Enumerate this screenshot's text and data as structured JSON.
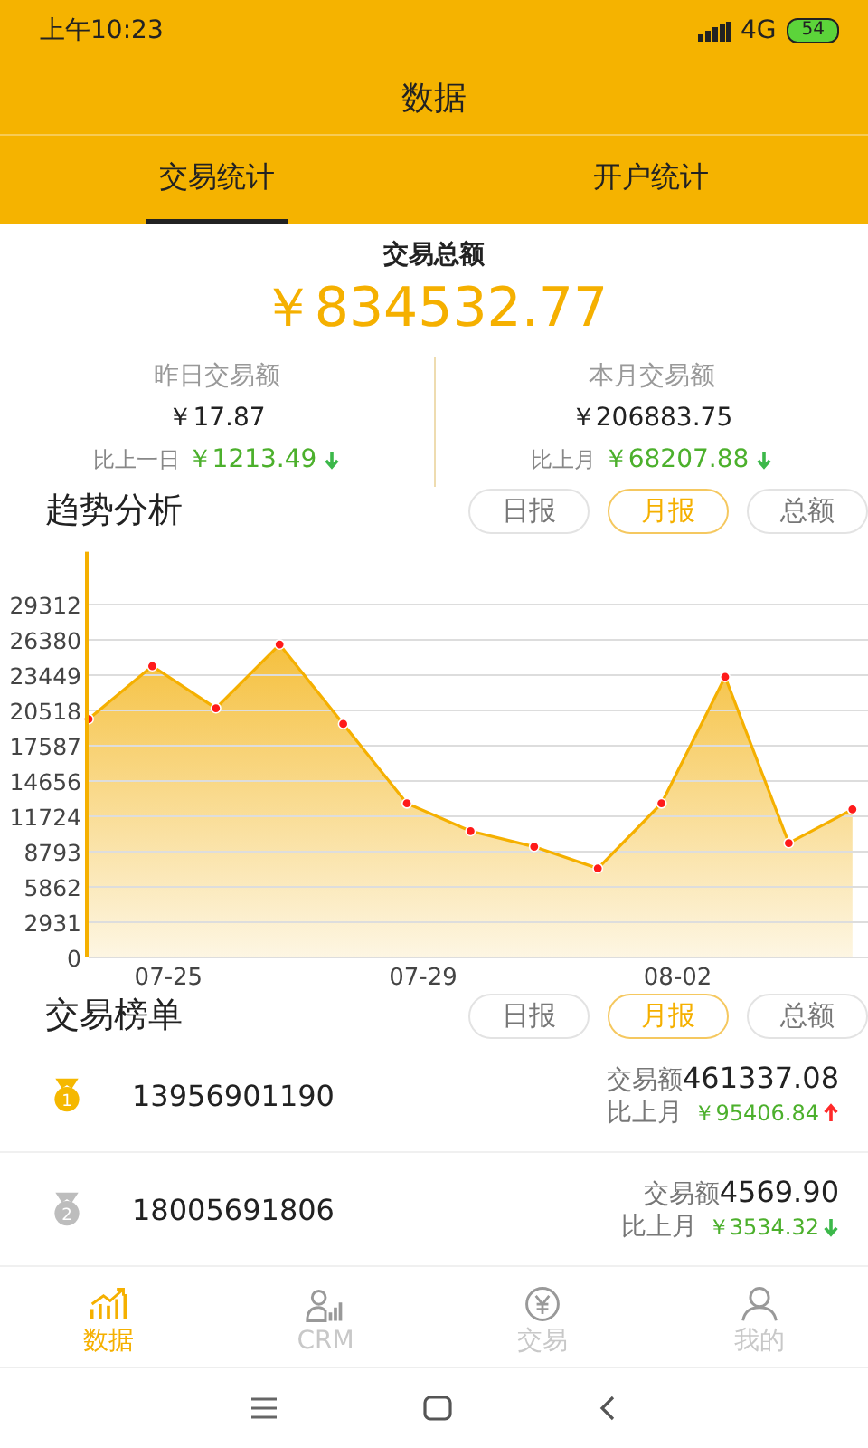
{
  "status_bar": {
    "time": "上午10:23",
    "network": "4G",
    "battery": "54"
  },
  "title": "数据",
  "tabs": [
    {
      "label": "交易统计",
      "selected": true
    },
    {
      "label": "开户统计",
      "selected": false
    }
  ],
  "summary": {
    "title": "交易总额",
    "total": "￥834532.77",
    "cards": [
      {
        "label": "昨日交易额",
        "value": "￥17.87",
        "compare_label": "比上一日",
        "compare_value": "￥1213.49",
        "increase": false
      },
      {
        "label": "本月交易额",
        "value": "￥206883.75",
        "compare_label": "比上月",
        "compare_value": "￥68207.88",
        "increase": false
      }
    ]
  },
  "trend": {
    "title": "趋势分析",
    "filters": [
      {
        "label": "日报",
        "selected": false
      },
      {
        "label": "月报",
        "selected": true
      },
      {
        "label": "总额",
        "selected": false
      }
    ],
    "chart_data": {
      "type": "area",
      "categories": [
        null,
        "07-25",
        null,
        null,
        null,
        "07-29",
        null,
        null,
        null,
        "08-02",
        null,
        null,
        null
      ],
      "series": [
        {
          "color": "#f5b000",
          "values": [
            19800,
            24200,
            20700,
            26000,
            19400,
            12800,
            10500,
            9200,
            7400,
            12800,
            23300,
            9500,
            12300
          ]
        }
      ],
      "grid": true,
      "ylim": [
        0,
        33700
      ],
      "yticks": [
        0,
        2931,
        5862,
        8793,
        11724,
        14656,
        17587,
        20518,
        23449,
        26380,
        29312
      ]
    }
  },
  "ranking": {
    "title": "交易榜单",
    "filters": [
      {
        "label": "日报",
        "selected": false
      },
      {
        "label": "月报",
        "selected": true
      },
      {
        "label": "总额",
        "selected": false
      }
    ],
    "rows": [
      {
        "rank": "1",
        "color": "#f5b800",
        "phone": "13956901190",
        "amount_label": "交易额",
        "amount": "461337.08",
        "compare_label": "比上月",
        "compare_value": "￥95406.84",
        "increase": true
      },
      {
        "rank": "2",
        "color": "#bdbdbd",
        "phone": "18005691806",
        "amount_label": "交易额",
        "amount": "4569.90",
        "compare_label": "比上月",
        "compare_value": "￥3534.32",
        "increase": false
      }
    ]
  },
  "bottom_nav": [
    {
      "label": "数据",
      "selected": true
    },
    {
      "label": "CRM",
      "selected": false
    },
    {
      "label": "交易",
      "selected": false
    },
    {
      "label": "我的",
      "selected": false
    }
  ]
}
